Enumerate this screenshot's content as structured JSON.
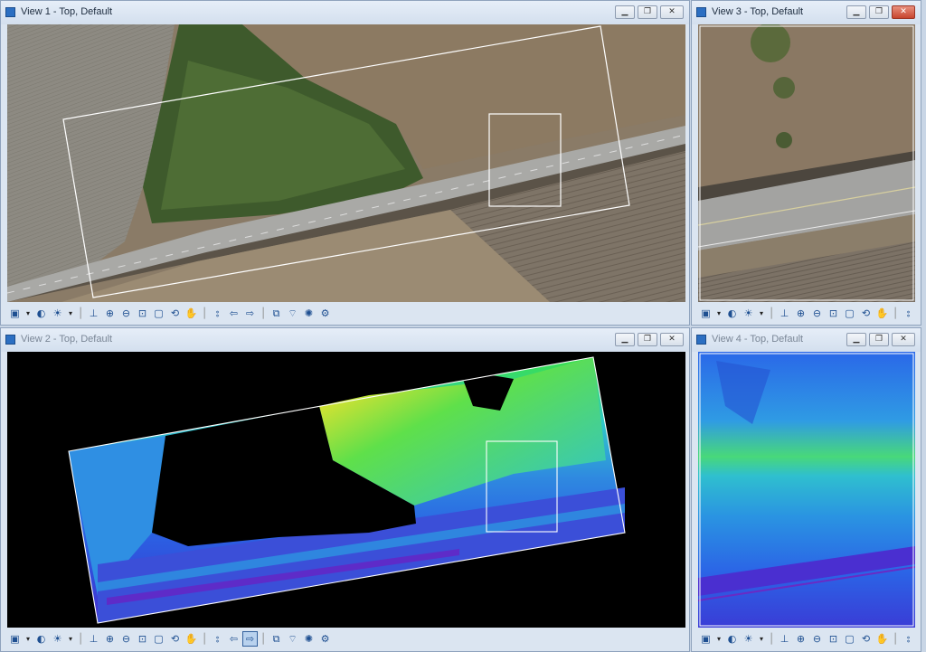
{
  "views": {
    "v1": {
      "title": "View 1 - Top, Default",
      "active": true
    },
    "v3": {
      "title": "View 3 - Top, Default",
      "active": true
    },
    "v2": {
      "title": "View 2 - Top, Default",
      "active": false
    },
    "v4": {
      "title": "View 4 - Top, Default",
      "active": false
    }
  },
  "window_controls": {
    "minimize": "▁",
    "restore": "❐",
    "close": "✕"
  },
  "toolbar": {
    "icons": [
      "view-attributes-icon",
      "dropdown-arrow-icon",
      "display-style-icon",
      "lighting-icon",
      "dropdown-arrow-icon",
      "clip-volume-icon",
      "zoom-in-icon",
      "zoom-out-icon",
      "window-area-icon",
      "fit-view-icon",
      "rotate-view-icon",
      "pan-view-icon",
      "walk-icon",
      "view-previous-icon",
      "view-next-icon",
      "copy-view-icon",
      "camera-icon",
      "render-icon",
      "tools-icon"
    ],
    "glyphs": {
      "view": "▣",
      "dd": "▾",
      "display": "◐",
      "light": "☀",
      "clip": "⊥",
      "zin": "⊕",
      "zout": "⊖",
      "area": "⊡",
      "fit": "▢",
      "rotate": "⟲",
      "pan": "✋",
      "walk": "⦂",
      "prev": "⇦",
      "next": "⇨",
      "copy": "⧉",
      "camera": "⌔",
      "render": "✺",
      "tools": "⚙"
    }
  },
  "colors": {
    "titlebar": "#dbe5f1",
    "viewport_bg_dem": "#000000",
    "selection_box": "#ffffff"
  }
}
